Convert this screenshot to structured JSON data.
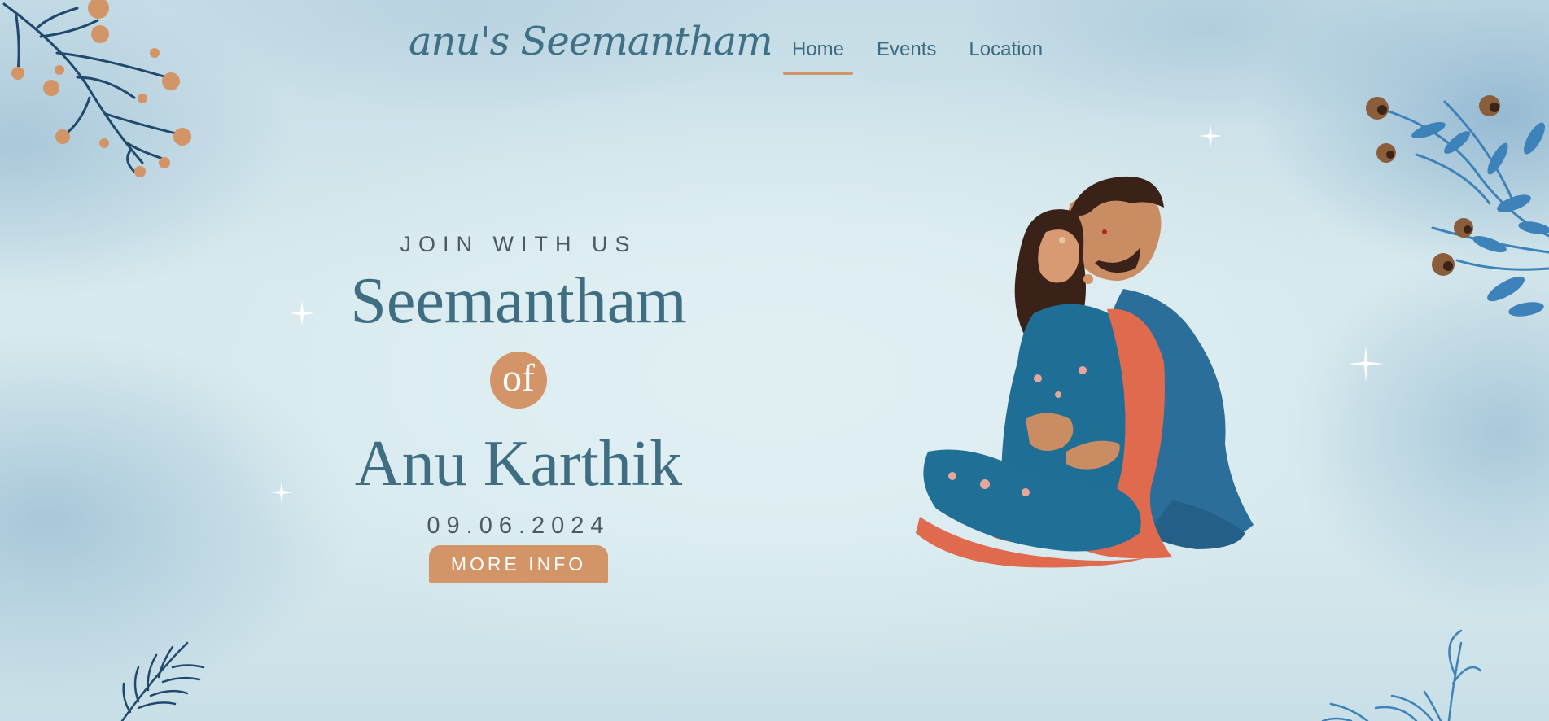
{
  "header": {
    "brand": "anu's Seemantham",
    "nav": [
      {
        "label": "Home",
        "active": true
      },
      {
        "label": "Events",
        "active": false
      },
      {
        "label": "Location",
        "active": false
      }
    ]
  },
  "hero": {
    "tagline": "JOIN WITH US",
    "event_name": "Seemantham",
    "connector": "of",
    "honoree": "Anu Karthik",
    "date": "09.06.2024",
    "cta_label": "MORE INFO"
  },
  "illustration": {
    "subject": "couple-illustration"
  },
  "colors": {
    "accent": "#d39467",
    "primary_text": "#3f6e82",
    "secondary_text": "#4a5a60",
    "background": "#d9ebef"
  }
}
